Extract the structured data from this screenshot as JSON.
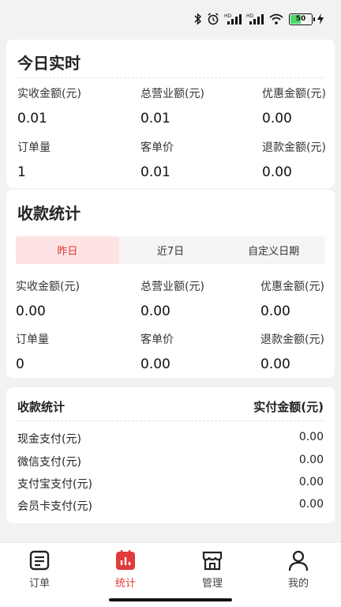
{
  "status_bar": {
    "icons": [
      "bluetooth-icon",
      "alarm-icon",
      "signal-hd-icon",
      "signal-hd-icon",
      "wifi-icon",
      "battery-icon",
      "charging-icon"
    ],
    "hd_label": "HD",
    "battery_level": "50"
  },
  "today": {
    "title": "今日实时",
    "row1": [
      {
        "label": "实收金额(元)",
        "value": "0.01"
      },
      {
        "label": "总营业额(元)",
        "value": "0.01"
      },
      {
        "label": "优惠金额(元)",
        "value": "0.00"
      }
    ],
    "row2": [
      {
        "label": "订单量",
        "value": "1"
      },
      {
        "label": "客单价",
        "value": "0.01"
      },
      {
        "label": "退款金额(元)",
        "value": "0.00"
      }
    ]
  },
  "stats": {
    "title": "收款统计",
    "tabs": [
      {
        "label": "昨日",
        "active": true
      },
      {
        "label": "近7日",
        "active": false
      },
      {
        "label": "自定义日期",
        "active": false
      }
    ],
    "row1": [
      {
        "label": "实收金额(元)",
        "value": "0.00"
      },
      {
        "label": "总营业额(元)",
        "value": "0.00"
      },
      {
        "label": "优惠金额(元)",
        "value": "0.00"
      }
    ],
    "row2": [
      {
        "label": "订单量",
        "value": "0"
      },
      {
        "label": "客单价",
        "value": "0.00"
      },
      {
        "label": "退款金额(元)",
        "value": "0.00"
      }
    ]
  },
  "payments": {
    "header_left": "收款统计",
    "header_right": "实付金额(元)",
    "rows": [
      {
        "label": "现金支付(元)",
        "value": "0.00"
      },
      {
        "label": "微信支付(元)",
        "value": "0.00"
      },
      {
        "label": "支付宝支付(元)",
        "value": "0.00"
      },
      {
        "label": "会员卡支付(元)",
        "value": "0.00"
      }
    ]
  },
  "tabbar": {
    "items": [
      {
        "label": "订单",
        "icon": "order-icon",
        "active": false
      },
      {
        "label": "统计",
        "icon": "stats-icon",
        "active": true
      },
      {
        "label": "管理",
        "icon": "store-icon",
        "active": false
      },
      {
        "label": "我的",
        "icon": "profile-icon",
        "active": false
      }
    ]
  },
  "colors": {
    "accent": "#e03a3a",
    "active_tab_bg": "#fde3e3",
    "background": "#f2f2f2"
  }
}
